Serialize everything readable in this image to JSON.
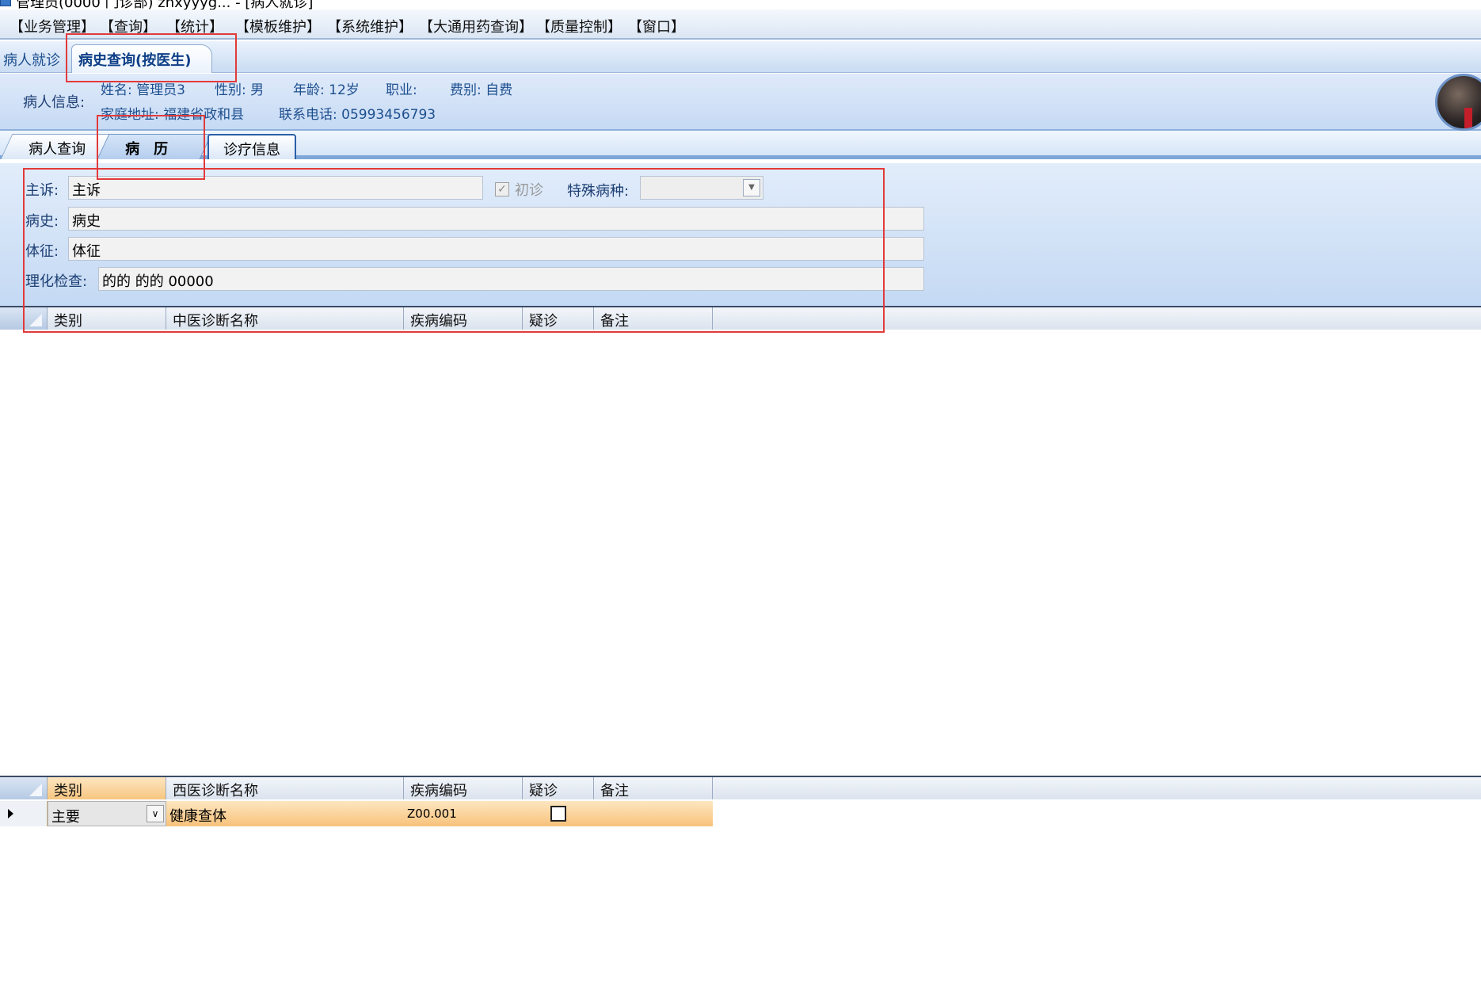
{
  "window": {
    "title_fragment": "管理员(0000 门诊部) zhxyyyg... - [病人就诊]"
  },
  "menu": [
    "【业务管理】",
    "【查询】",
    "【统计】",
    "【模板维护】",
    "【系统维护】",
    "【大通用药查询】",
    "【质量控制】",
    "【窗口】"
  ],
  "doc_tabs": {
    "tab1": "病人就诊",
    "tab2": "病史查询(按医生)"
  },
  "patient": {
    "section_label": "病人信息:",
    "name": "姓名: 管理员3",
    "gender": "性别: 男",
    "age": "年龄: 12岁",
    "occupation": "职业:",
    "fee_type": "费别: 自费",
    "address": "家庭地址: 福建省政和县",
    "phone": "联系电话: 05993456793"
  },
  "sub_tabs": {
    "tab1": "病人查询",
    "tab2": "病历",
    "tab3": "诊疗信息"
  },
  "form": {
    "chief_complaint_label": "主诉:",
    "chief_complaint_value": "主诉",
    "first_visit_label": "初诊",
    "first_visit_checked": true,
    "special_disease_label": "特殊病种:",
    "special_disease_value": "",
    "history_label": "病史:",
    "history_value": "病史",
    "signs_label": "体征:",
    "signs_value": "体征",
    "lab_label": "理化检查:",
    "lab_value": "的的 的的 00000"
  },
  "tcm_grid": {
    "columns": [
      "类别",
      "中医诊断名称",
      "疾病编码",
      "疑诊",
      "备注"
    ],
    "rows": []
  },
  "wm_grid": {
    "columns": [
      "类别",
      "西医诊断名称",
      "疾病编码",
      "疑诊",
      "备注"
    ],
    "rows": [
      {
        "type": "主要",
        "name": "健康查体",
        "code": "Z00.001",
        "suspected": false,
        "note": ""
      }
    ]
  },
  "colors": {
    "accent_blue": "#1d4f8f",
    "selected_row": "#f8c27a",
    "annotation_red": "#e23a3a"
  },
  "icons": {
    "avatar": "user-avatar",
    "row_indicator": "triangle-right-icon",
    "dropdown": "chevron-down-icon"
  }
}
